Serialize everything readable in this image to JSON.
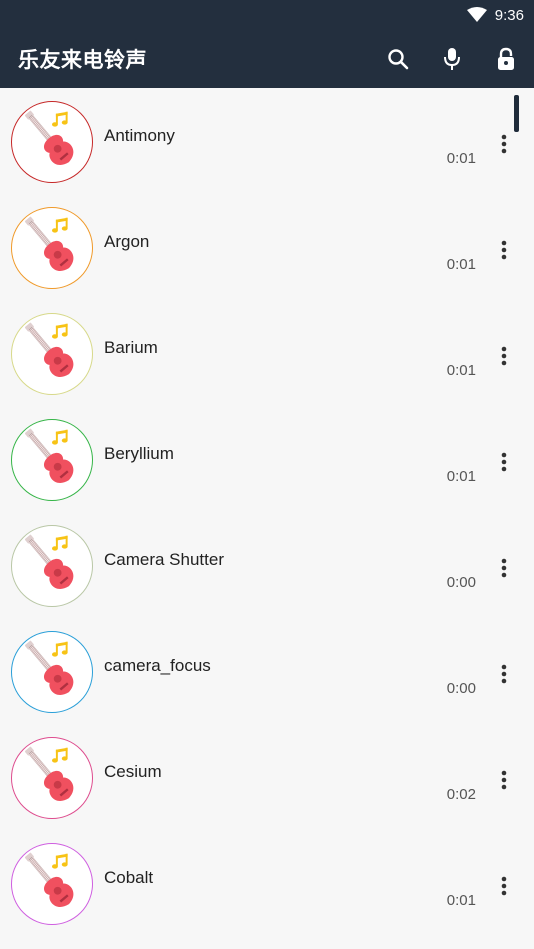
{
  "status_bar": {
    "time": "9:36"
  },
  "app_bar": {
    "title": "乐友来电铃声"
  },
  "ringtones": [
    {
      "name": "Antimony",
      "duration": "0:01",
      "ring_color": "#c62828"
    },
    {
      "name": "Argon",
      "duration": "0:01",
      "ring_color": "#f09a2a"
    },
    {
      "name": "Barium",
      "duration": "0:01",
      "ring_color": "#d7d98a"
    },
    {
      "name": "Beryllium",
      "duration": "0:01",
      "ring_color": "#36b548"
    },
    {
      "name": "Camera Shutter",
      "duration": "0:00",
      "ring_color": "#b9c7a6"
    },
    {
      "name": "camera_focus",
      "duration": "0:00",
      "ring_color": "#2a9fd8"
    },
    {
      "name": "Cesium",
      "duration": "0:02",
      "ring_color": "#de4c8e"
    },
    {
      "name": "Cobalt",
      "duration": "0:01",
      "ring_color": "#cf5fe0"
    }
  ],
  "colors": {
    "bar_background": "#232f3e",
    "list_background": "#f7f7f7",
    "guitar_body": "#f0505f",
    "music_note": "#f7c315"
  },
  "icons": {
    "search": "search-icon",
    "mic": "microphone-icon",
    "lock": "lock-icon",
    "more": "more-vertical-icon",
    "wifi": "wifi-icon"
  }
}
